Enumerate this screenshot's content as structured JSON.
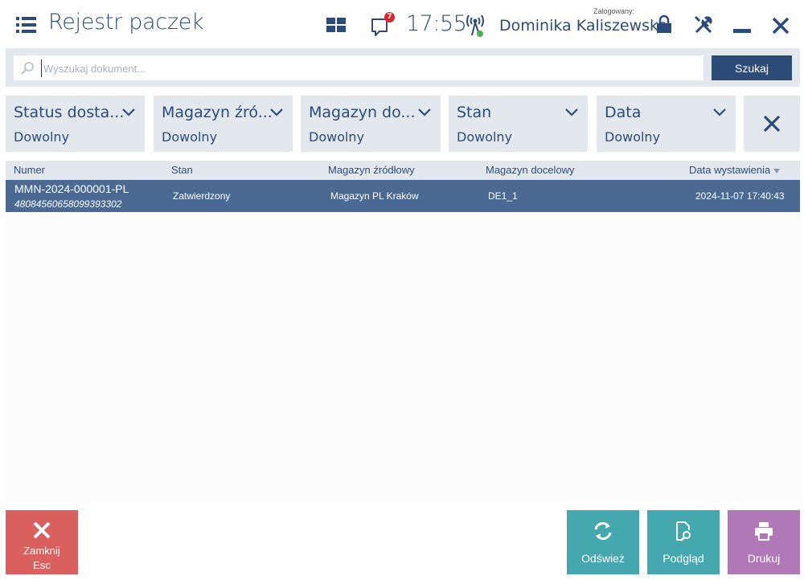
{
  "header": {
    "title": "Rejestr paczek",
    "clock": "17:55",
    "notification_count": "7",
    "logged_label": "Zalogowany:",
    "user_name": "Dominika Kaliszewska"
  },
  "search": {
    "placeholder": "Wyszukaj dokument...",
    "button_label": "Szukaj"
  },
  "filters": [
    {
      "label": "Status dosta...",
      "value": "Dowolny"
    },
    {
      "label": "Magazyn źró...",
      "value": "Dowolny"
    },
    {
      "label": "Magazyn do...",
      "value": "Dowolny"
    },
    {
      "label": "Stan",
      "value": "Dowolny"
    },
    {
      "label": "Data",
      "value": "Dowolny"
    }
  ],
  "table": {
    "columns": [
      "Numer",
      "Stan",
      "Magazyn źródłowy",
      "Magazyn docelowy",
      "Data wystawienia"
    ],
    "rows": [
      {
        "numer": "MMN-2024-000001-PL",
        "kod": "48084560658099393302",
        "stan": "Zatwierdzony",
        "magazyn_zrodlowy": "Magazyn PL Kraków",
        "magazyn_docelowy": "DE1_1",
        "data": "2024-11-07 17:40:43"
      }
    ]
  },
  "buttons": {
    "close_label": "Zamknij",
    "close_shortcut": "Esc",
    "refresh_label": "Odśwież",
    "preview_label": "Podgląd",
    "print_label": "Drukuj"
  },
  "colors": {
    "primary": "#2d4b78",
    "selected_row": "#4a6a94",
    "panel": "#e3e8ef",
    "close_button": "#d9605f",
    "action_button": "#45a8ae",
    "print_button": "#b178b7",
    "badge": "#d9262e",
    "status_dot": "#4caf50"
  },
  "icons": {
    "menu": "menu-icon",
    "tiles": "tiles-icon",
    "notifications": "chat-bubble-icon",
    "signal": "signal-tower-icon",
    "lock": "lock-icon",
    "tools": "tools-icon",
    "minimize": "minimize-icon",
    "close": "close-icon"
  }
}
